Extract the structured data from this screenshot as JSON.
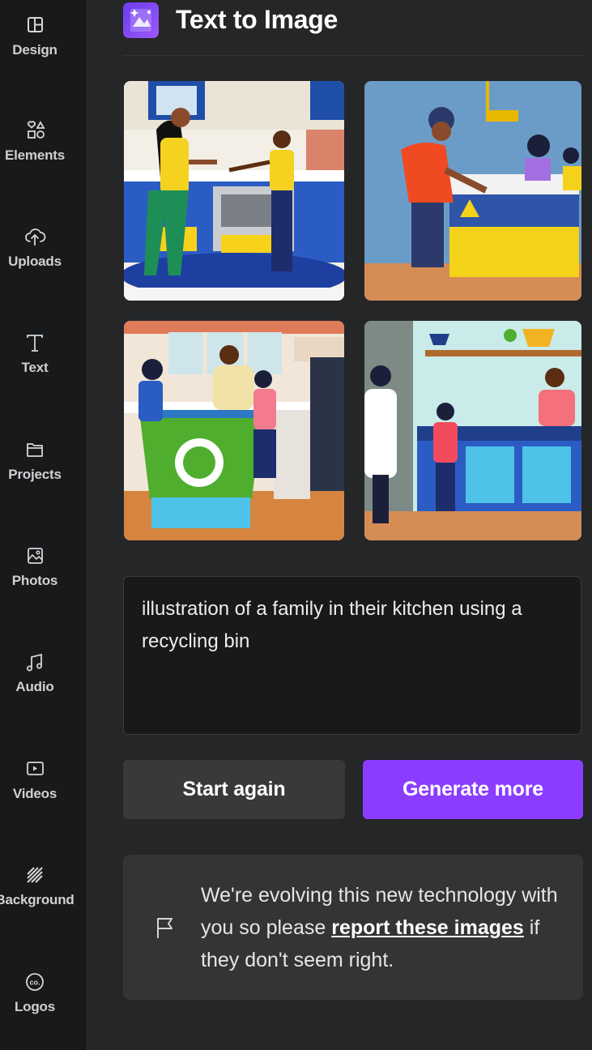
{
  "sidebar": {
    "items": [
      {
        "label": "Design",
        "icon": "layout-icon"
      },
      {
        "label": "Elements",
        "icon": "shapes-icon"
      },
      {
        "label": "Uploads",
        "icon": "cloud-upload-icon"
      },
      {
        "label": "Text",
        "icon": "text-icon"
      },
      {
        "label": "Projects",
        "icon": "folder-icon"
      },
      {
        "label": "Photos",
        "icon": "image-icon"
      },
      {
        "label": "Audio",
        "icon": "music-note-icon"
      },
      {
        "label": "Videos",
        "icon": "video-icon"
      },
      {
        "label": "Background",
        "icon": "stripes-icon"
      },
      {
        "label": "Logos",
        "icon": "logo-badge-icon"
      }
    ]
  },
  "header": {
    "title": "Text to Image",
    "icon": "text-to-image-app-icon"
  },
  "images": [
    {
      "name": "generated-image-1",
      "icon": "kitchen-illustration"
    },
    {
      "name": "generated-image-2",
      "icon": "kitchen-illustration"
    },
    {
      "name": "generated-image-3",
      "icon": "kitchen-illustration"
    },
    {
      "name": "generated-image-4",
      "icon": "kitchen-illustration"
    }
  ],
  "prompt": {
    "value": "illustration of a family in their kitchen using a recycling bin"
  },
  "actions": {
    "start_again_label": "Start again",
    "generate_more_label": "Generate more"
  },
  "notice": {
    "text_before": "We're evolving this new technology with you so please ",
    "link_text": "report these images",
    "text_after": " if they don't seem right.",
    "icon": "flag-icon"
  },
  "colors": {
    "accent": "#8b3dff",
    "sidebar_bg": "#18191b",
    "panel_bg": "#252627"
  }
}
